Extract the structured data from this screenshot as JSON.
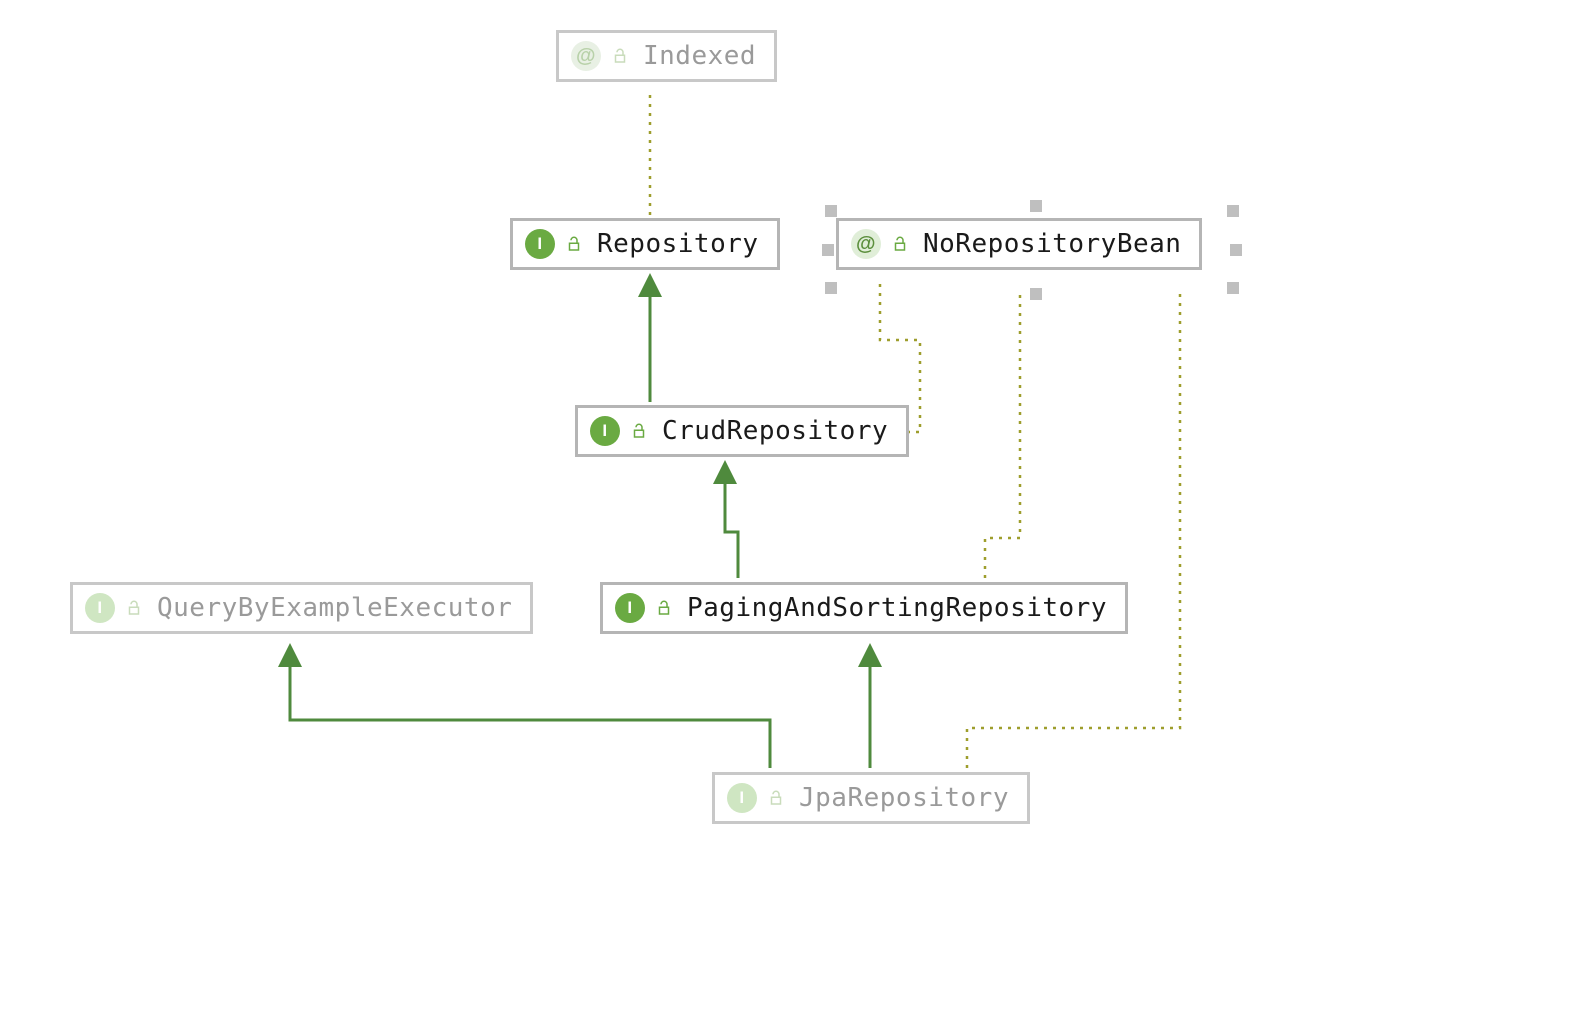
{
  "diagram": {
    "kind": "class-hierarchy",
    "nodes": {
      "indexed": {
        "label": "Indexed",
        "type": "annotation",
        "faded": true
      },
      "repository": {
        "label": "Repository",
        "type": "interface",
        "faded": false
      },
      "noRepoBean": {
        "label": "NoRepositoryBean",
        "type": "annotation",
        "faded": false,
        "selected": true
      },
      "crud": {
        "label": "CrudRepository",
        "type": "interface",
        "faded": false
      },
      "qbe": {
        "label": "QueryByExampleExecutor",
        "type": "interface",
        "faded": true
      },
      "pasr": {
        "label": "PagingAndSortingRepository",
        "type": "interface",
        "faded": false
      },
      "jpa": {
        "label": "JpaRepository",
        "type": "interface",
        "faded": true
      }
    },
    "edges": [
      {
        "from": "repository",
        "to": "indexed",
        "style": "dotted",
        "color": "olive"
      },
      {
        "from": "crud",
        "to": "repository",
        "style": "solid",
        "color": "green"
      },
      {
        "from": "crud",
        "to": "noRepoBean",
        "style": "dotted",
        "color": "olive"
      },
      {
        "from": "pasr",
        "to": "crud",
        "style": "solid",
        "color": "green"
      },
      {
        "from": "pasr",
        "to": "noRepoBean",
        "style": "dotted",
        "color": "olive"
      },
      {
        "from": "jpa",
        "to": "pasr",
        "style": "solid",
        "color": "green"
      },
      {
        "from": "jpa",
        "to": "qbe",
        "style": "solid",
        "color": "green"
      },
      {
        "from": "jpa",
        "to": "noRepoBean",
        "style": "dotted",
        "color": "olive"
      }
    ],
    "colors": {
      "border_normal": "#b5b5b5",
      "border_faded": "#c8c8c8",
      "text_normal": "#1a1a1a",
      "text_faded": "#9a9a9a",
      "iface_green": "#6aaa42",
      "arrow_green": "#4f8a3d",
      "dotted_olive": "#9e9e2c",
      "handle_gray": "#bfbfbf"
    }
  }
}
